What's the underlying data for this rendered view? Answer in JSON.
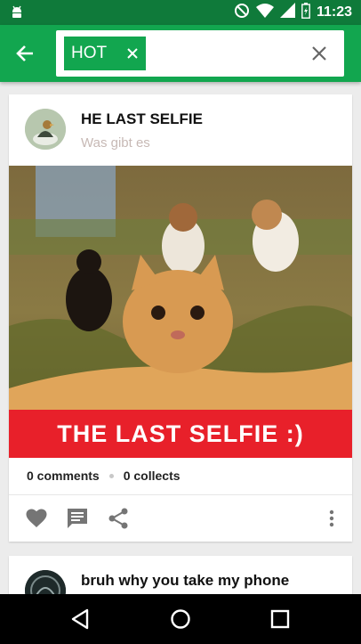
{
  "status_bar": {
    "time": "11:23"
  },
  "app_bar": {
    "filter_chip": {
      "label": "HOT"
    }
  },
  "posts": [
    {
      "title": "HE LAST SELFIE",
      "subtitle": "Was gibt es",
      "image_caption": "THE LAST SELFIE :)",
      "comments_label": "0 comments",
      "collects_label": "0 collects"
    },
    {
      "title": "bruh why you take my phone"
    }
  ],
  "icons": {
    "status": [
      "android-icon",
      "do-not-disturb-icon",
      "wifi-icon",
      "signal-icon",
      "battery-icon"
    ],
    "app_bar": [
      "back-arrow-icon",
      "chip-close-icon",
      "clear-icon"
    ],
    "post_actions": [
      "heart-icon",
      "comment-icon",
      "share-icon",
      "more-vert-icon"
    ],
    "navigation": [
      "nav-back-icon",
      "nav-home-icon",
      "nav-recents-icon"
    ]
  },
  "colors": {
    "primary": "#12a64f",
    "primary_dark": "#0f7a3a",
    "caption_band": "#e8202a"
  }
}
